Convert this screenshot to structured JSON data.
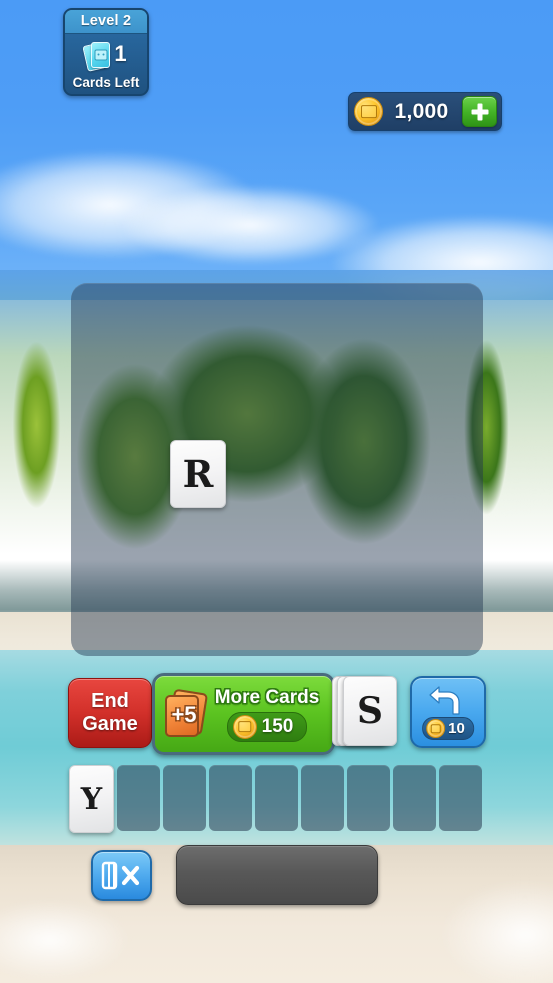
{
  "level_badge": {
    "title": "Level 2",
    "cards_left_count": "1",
    "cards_left_label": "Cards Left",
    "card_icon": "playing-cards-icon"
  },
  "coin_bar": {
    "coin_icon": "gold-coin-icon",
    "amount": "1,000",
    "add_button_icon": "plus-icon"
  },
  "play_area": {
    "played_cards": [
      {
        "letter": "R"
      }
    ]
  },
  "actions": {
    "end_game": {
      "line1": "End",
      "line2": "Game"
    },
    "more_cards": {
      "label": "More Cards",
      "bonus_text": "+5",
      "cost": "150",
      "coin_icon": "gold-coin-icon",
      "cards_icon": "orange-cards-icon"
    },
    "deck": {
      "top_letter": "S",
      "icon": "card-deck-icon"
    },
    "undo": {
      "icon": "undo-arrow-icon",
      "cost": "10",
      "coin_icon": "gold-coin-icon"
    }
  },
  "rack": {
    "slots": [
      {
        "letter": "Y",
        "filled": true
      },
      {
        "letter": "",
        "filled": false
      },
      {
        "letter": "",
        "filled": false
      },
      {
        "letter": "",
        "filled": false
      },
      {
        "letter": "",
        "filled": false
      },
      {
        "letter": "",
        "filled": false
      },
      {
        "letter": "",
        "filled": false
      },
      {
        "letter": "",
        "filled": false
      },
      {
        "letter": "",
        "filled": false
      }
    ]
  },
  "bottom_bar": {
    "clear_button_icon": "clear-cards-icon",
    "submit_button_label": ""
  },
  "colors": {
    "sky_blue": "#4b9bf6",
    "ocean_teal": "#6fccd6",
    "sand": "#f0ece2",
    "badge_blue": "#255f93",
    "coin_gold": "#ffc72e",
    "green_button": "#5cc421",
    "red_button": "#d2302a",
    "undo_blue": "#4aa9ef",
    "play_area_overlay": "rgba(35,55,80,.46)"
  }
}
